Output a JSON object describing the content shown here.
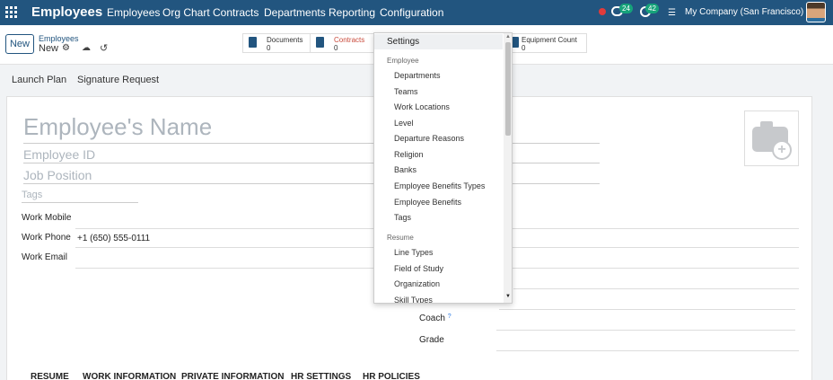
{
  "navbar": {
    "app_name": "Employees",
    "menu": [
      "Employees",
      "Org Chart",
      "Contracts",
      "Departments",
      "Reporting",
      "Configuration"
    ],
    "messages_count": "24",
    "activities_count": "42",
    "company": "My Company (San Francisco)"
  },
  "control_panel": {
    "new_label": "New",
    "breadcrumb_parent": "Employees",
    "breadcrumb_current": "New",
    "smart_buttons": [
      {
        "label": "Documents",
        "count": "0"
      },
      {
        "label": "Contracts",
        "count": "0"
      },
      {
        "label": "Equipment Count",
        "count": "0"
      }
    ]
  },
  "actions": [
    "Launch Plan",
    "Signature Request"
  ],
  "form": {
    "name_placeholder": "Employee's Name",
    "employee_id_placeholder": "Employee ID",
    "job_position_placeholder": "Job Position",
    "tags_placeholder": "Tags",
    "work_mobile_label": "Work Mobile",
    "work_phone_label": "Work Phone",
    "work_phone_value": "+1 (650) 555-0111",
    "work_email_label": "Work Email",
    "coach_label": "Coach",
    "coach_help": "?",
    "grade_label": "Grade",
    "tabs": [
      "RESUME",
      "WORK INFORMATION",
      "PRIVATE INFORMATION",
      "HR SETTINGS",
      "HR POLICIES"
    ]
  },
  "config_dropdown": {
    "settings": "Settings",
    "employee_header": "Employee",
    "employee_items": [
      "Departments",
      "Teams",
      "Work Locations",
      "Level",
      "Departure Reasons",
      "Religion",
      "Banks",
      "Employee Benefits Types",
      "Employee Benefits",
      "Tags"
    ],
    "resume_header": "Resume",
    "resume_items": [
      "Line Types",
      "Field of Study",
      "Organization",
      "Skill Types"
    ]
  },
  "colors": {
    "navbar": "#22557f",
    "accent": "#22557f",
    "badge": "#16a37a",
    "contracts_text": "#c94a3b"
  }
}
